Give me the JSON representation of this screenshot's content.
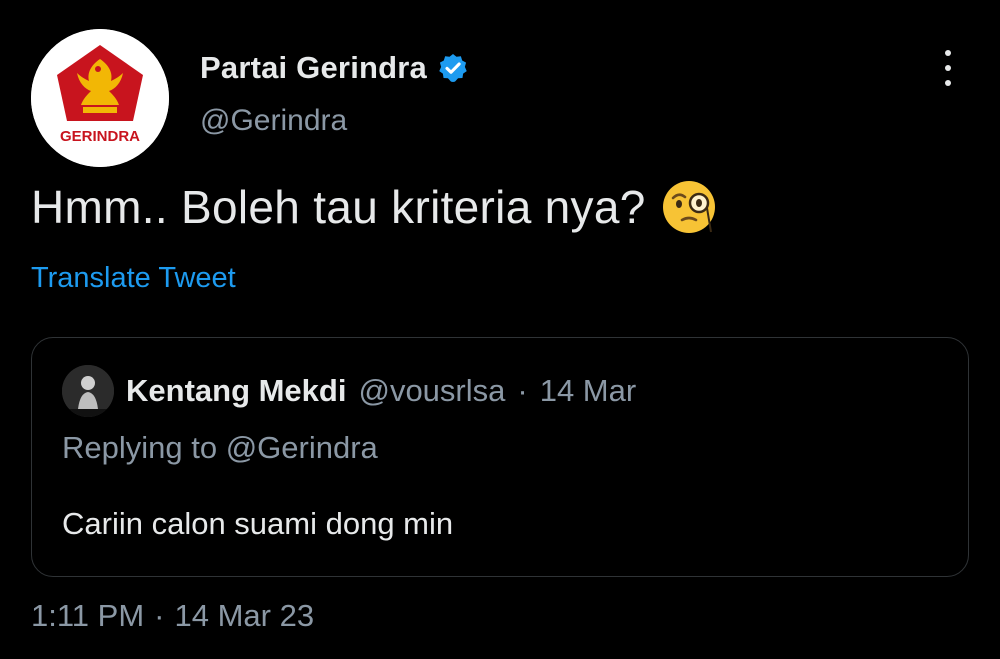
{
  "author": {
    "display_name": "Partai Gerindra",
    "handle": "@Gerindra",
    "verified": true,
    "avatar_icon": "garuda-logo-icon",
    "avatar_label": "GERINDRA"
  },
  "tweet": {
    "text": "Hmm.. Boleh tau kriteria nya?",
    "emoji": "face-with-monocle-icon",
    "translate_label": "Translate Tweet"
  },
  "quote": {
    "display_name": "Kentang Mekdi",
    "handle": "@vousrlsa",
    "separator": "·",
    "date": "14 Mar",
    "replying_to": "Replying to @Gerindra",
    "text": "Cariin calon suami dong min"
  },
  "meta": {
    "time": "1:11 PM",
    "separator": "·",
    "date": "14 Mar 23"
  },
  "colors": {
    "background": "#000000",
    "text_primary": "#e7e9ea",
    "text_secondary": "#8b98a5",
    "link": "#1d9bf0",
    "border": "#2f3336",
    "verified": "#1d9bf0",
    "logo_red": "#c8141e",
    "logo_gold": "#f2b705"
  }
}
